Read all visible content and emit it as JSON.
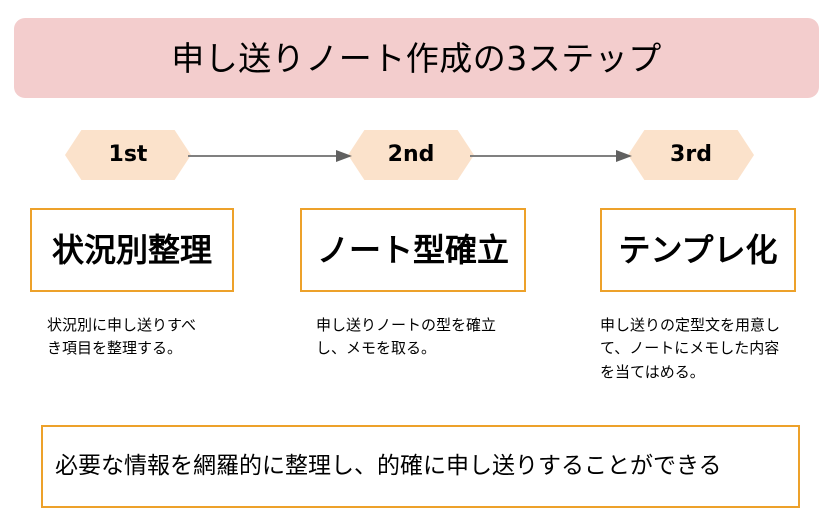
{
  "title": {
    "text": "申し送りノート作成の3ステップ",
    "background_color": "#f3cdcd"
  },
  "steps": [
    {
      "marker": "1st",
      "heading": "状況別整理",
      "description": "状況別に申し送りすべき項目を整理する。"
    },
    {
      "marker": "2nd",
      "heading": "ノート型確立",
      "description": "申し送りノートの型を確立し、メモを取る。"
    },
    {
      "marker": "3rd",
      "heading": "テンプレ化",
      "description": "申し送りの定型文を用意して、ノートにメモした内容を当てはめる。"
    }
  ],
  "connectors": [
    {
      "name": "arrow-step1-to-step2",
      "icon": "arrow-right-icon"
    },
    {
      "name": "arrow-step2-to-step3",
      "icon": "arrow-right-icon"
    }
  ],
  "summary": {
    "text": "必要な情報を網羅的に整理し、的確に申し送りすることができる"
  },
  "colors": {
    "banner_pink": "#f3cdcd",
    "hexagon_peach": "#fbe2cb",
    "box_border_orange": "#eda12a",
    "arrow_gray": "#808080",
    "text_black": "#000000",
    "background_white": "#ffffff"
  }
}
